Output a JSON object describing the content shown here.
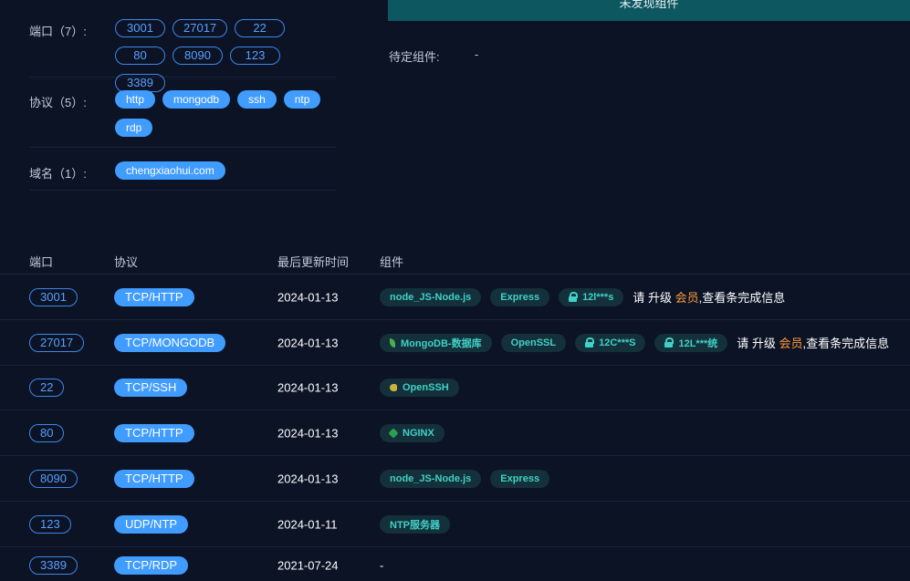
{
  "summary": {
    "ports_label": "端口（7）:",
    "ports": [
      "3001",
      "27017",
      "22",
      "80",
      "8090",
      "123",
      "3389"
    ],
    "protocols_label": "协议（5）:",
    "protocols": [
      "http",
      "mongodb",
      "ssh",
      "ntp",
      "rdp"
    ],
    "domains_label": "域名（1）:",
    "domains": [
      "chengxiaohui.com"
    ]
  },
  "components_panel": {
    "banner": "未发现组件",
    "pending_label": "待定组件:",
    "pending_value": "-"
  },
  "table": {
    "headers": {
      "port": "端口",
      "protocol": "协议",
      "updated": "最后更新时间",
      "components": "组件"
    },
    "upgrade_prefix": "请 升级 ",
    "upgrade_vip": "会员",
    "upgrade_suffix": ",查看条完成信息",
    "rows": [
      {
        "port": "3001",
        "protocol": "TCP/HTTP",
        "date": "2024-01-13",
        "components": [
          {
            "name": "node_JS-Node.js",
            "icon": ""
          },
          {
            "name": "Express",
            "icon": ""
          },
          {
            "name": "12l***s",
            "icon": "lock-icon"
          }
        ],
        "upgrade": true
      },
      {
        "port": "27017",
        "protocol": "TCP/MONGODB",
        "date": "2024-01-13",
        "components": [
          {
            "name": "MongoDB-数据库",
            "icon": "mongodb-leaf-icon"
          },
          {
            "name": "OpenSSL",
            "icon": ""
          },
          {
            "name": "12C***S",
            "icon": "lock-icon"
          },
          {
            "name": "12L***统",
            "icon": "lock-icon"
          }
        ],
        "upgrade": true
      },
      {
        "port": "22",
        "protocol": "TCP/SSH",
        "date": "2024-01-13",
        "components": [
          {
            "name": "OpenSSH",
            "icon": "openssh-fish-icon"
          }
        ],
        "upgrade": false
      },
      {
        "port": "80",
        "protocol": "TCP/HTTP",
        "date": "2024-01-13",
        "components": [
          {
            "name": "NGINX",
            "icon": "nginx-icon"
          }
        ],
        "upgrade": false
      },
      {
        "port": "8090",
        "protocol": "TCP/HTTP",
        "date": "2024-01-13",
        "components": [
          {
            "name": "node_JS-Node.js",
            "icon": ""
          },
          {
            "name": "Express",
            "icon": ""
          }
        ],
        "upgrade": false
      },
      {
        "port": "123",
        "protocol": "UDP/NTP",
        "date": "2024-01-11",
        "components": [
          {
            "name": "NTP服务器",
            "icon": ""
          }
        ],
        "upgrade": false
      },
      {
        "port": "3389",
        "protocol": "TCP/RDP",
        "date": "2021-07-24",
        "components": [],
        "empty_value": "-",
        "upgrade": false
      }
    ]
  }
}
